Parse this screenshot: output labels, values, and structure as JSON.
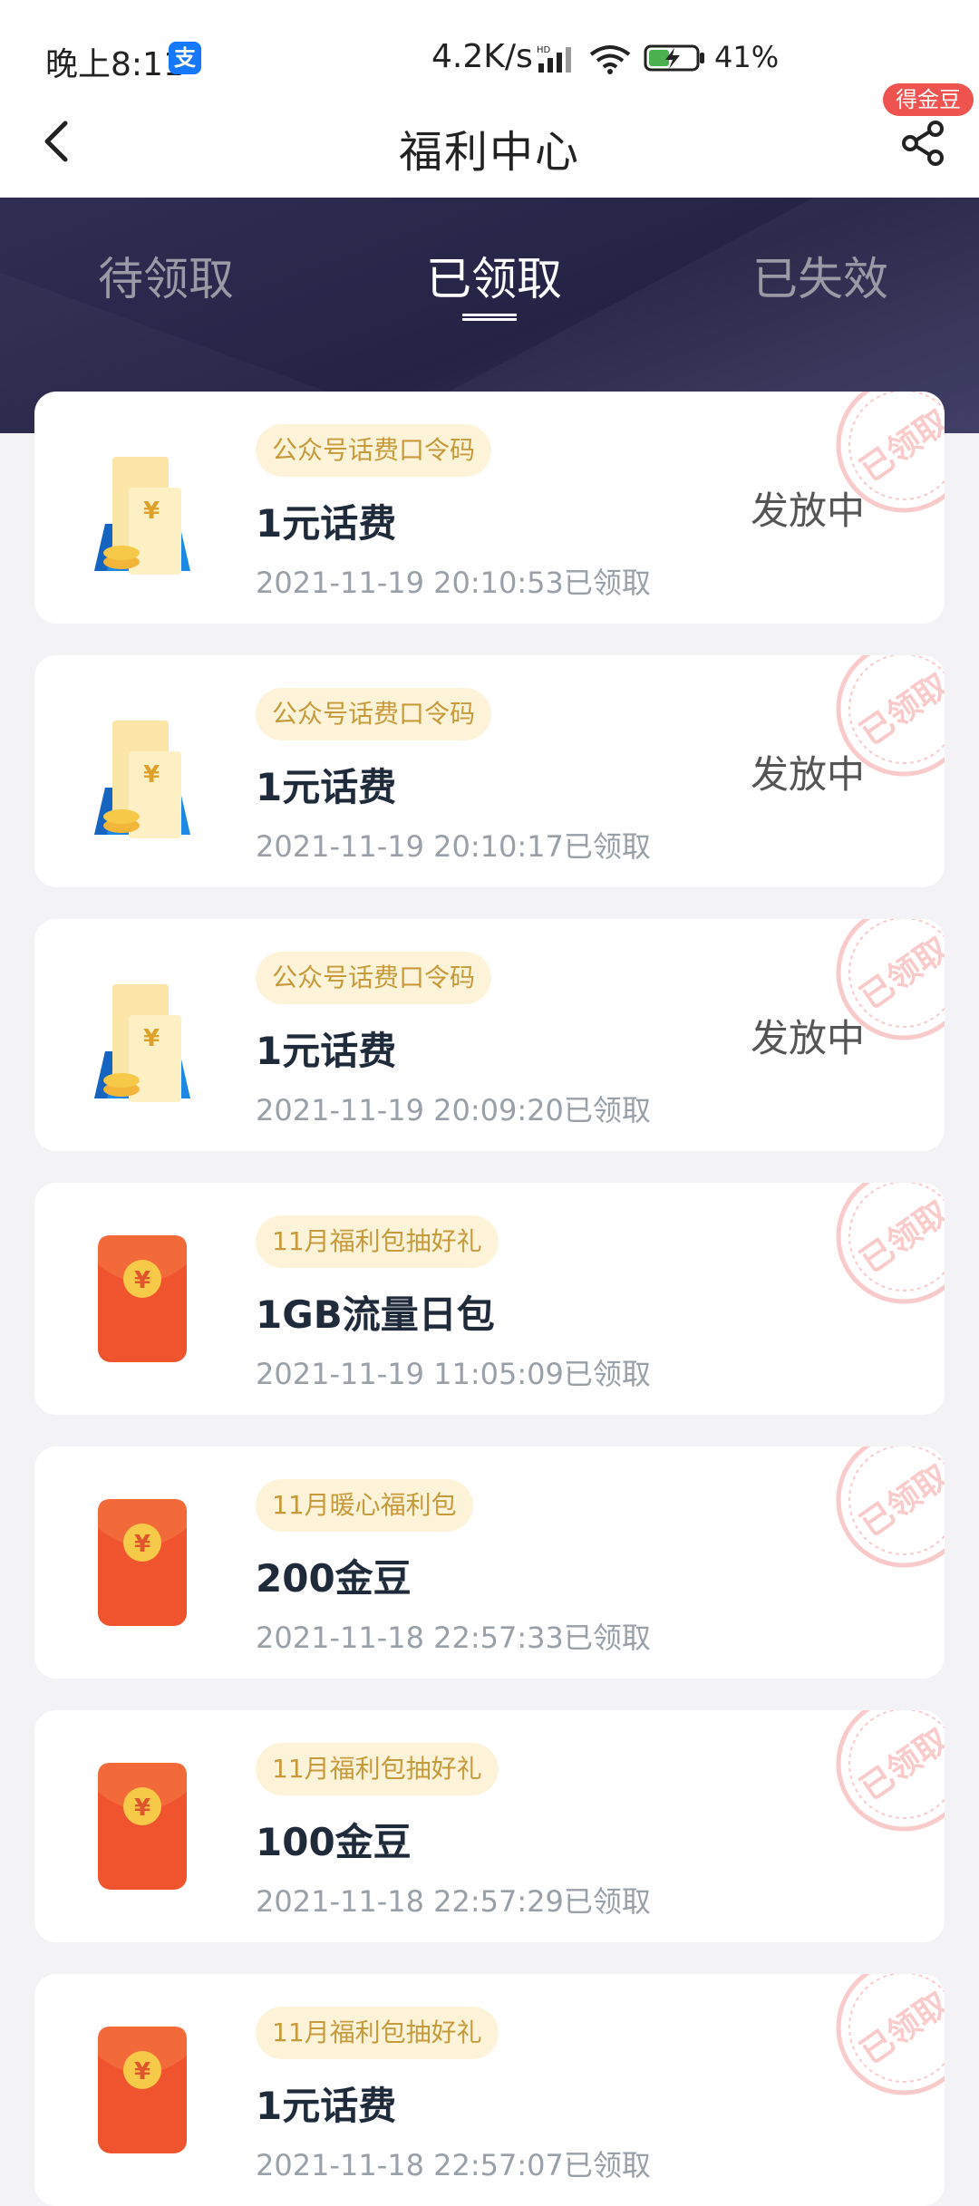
{
  "status_bar": {
    "time": "晚上8:11",
    "alipay_glyph": "支",
    "net_speed": "4.2K/s",
    "hd_label": "HD",
    "battery_percent": "41%"
  },
  "header": {
    "title": "福利中心",
    "badge": "得金豆",
    "back_icon": "chevron-left-icon",
    "share_icon": "share-icon"
  },
  "tabs": [
    {
      "label": "待领取",
      "active": false
    },
    {
      "label": "已领取",
      "active": true
    },
    {
      "label": "已失效",
      "active": false
    }
  ],
  "stamp_text": "已领取",
  "cards": [
    {
      "icon": "phone-credit-icon",
      "tag": "公众号话费口令码",
      "title": "1元话费",
      "time": "2021-11-19 20:10:53已领取",
      "status": "发放中"
    },
    {
      "icon": "phone-credit-icon",
      "tag": "公众号话费口令码",
      "title": "1元话费",
      "time": "2021-11-19 20:10:17已领取",
      "status": "发放中"
    },
    {
      "icon": "phone-credit-icon",
      "tag": "公众号话费口令码",
      "title": "1元话费",
      "time": "2021-11-19 20:09:20已领取",
      "status": "发放中"
    },
    {
      "icon": "red-envelope-icon",
      "tag": "11月福利包抽好礼",
      "title": "1GB流量日包",
      "time": "2021-11-19 11:05:09已领取",
      "status": ""
    },
    {
      "icon": "red-envelope-icon",
      "tag": "11月暖心福利包",
      "title": "200金豆",
      "time": "2021-11-18 22:57:33已领取",
      "status": ""
    },
    {
      "icon": "red-envelope-icon",
      "tag": "11月福利包抽好礼",
      "title": "100金豆",
      "time": "2021-11-18 22:57:29已领取",
      "status": ""
    },
    {
      "icon": "red-envelope-icon",
      "tag": "11月福利包抽好礼",
      "title": "1元话费",
      "time": "2021-11-18 22:57:07已领取",
      "status": ""
    }
  ],
  "colors": {
    "header_bg": "#2f2d52",
    "tag_bg": "#fdf3d9",
    "tag_text": "#c99a3c",
    "badge_bg": "#ef5350",
    "envelope": "#f0542e",
    "coin": "#f7c948"
  }
}
